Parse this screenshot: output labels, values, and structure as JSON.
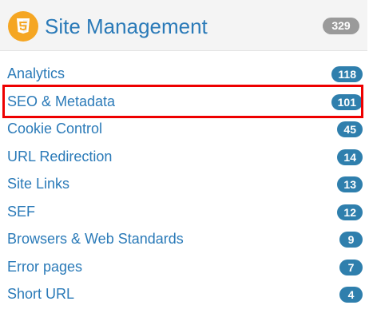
{
  "header": {
    "title": "Site Management",
    "count": "329",
    "icon": "html5-icon",
    "icon_color": "#f5a623"
  },
  "items": [
    {
      "label": "Analytics",
      "count": "118"
    },
    {
      "label": "SEO & Metadata",
      "count": "101"
    },
    {
      "label": "Cookie Control",
      "count": "45"
    },
    {
      "label": "URL Redirection",
      "count": "14"
    },
    {
      "label": "Site Links",
      "count": "13"
    },
    {
      "label": "SEF",
      "count": "12"
    },
    {
      "label": "Browsers & Web Standards",
      "count": "9"
    },
    {
      "label": "Error pages",
      "count": "7"
    },
    {
      "label": "Short URL",
      "count": "4"
    }
  ],
  "colors": {
    "link": "#2a7ab8",
    "badge": "#2f7fad",
    "header_badge": "#9a9a9a",
    "highlight": "#ee0000"
  }
}
